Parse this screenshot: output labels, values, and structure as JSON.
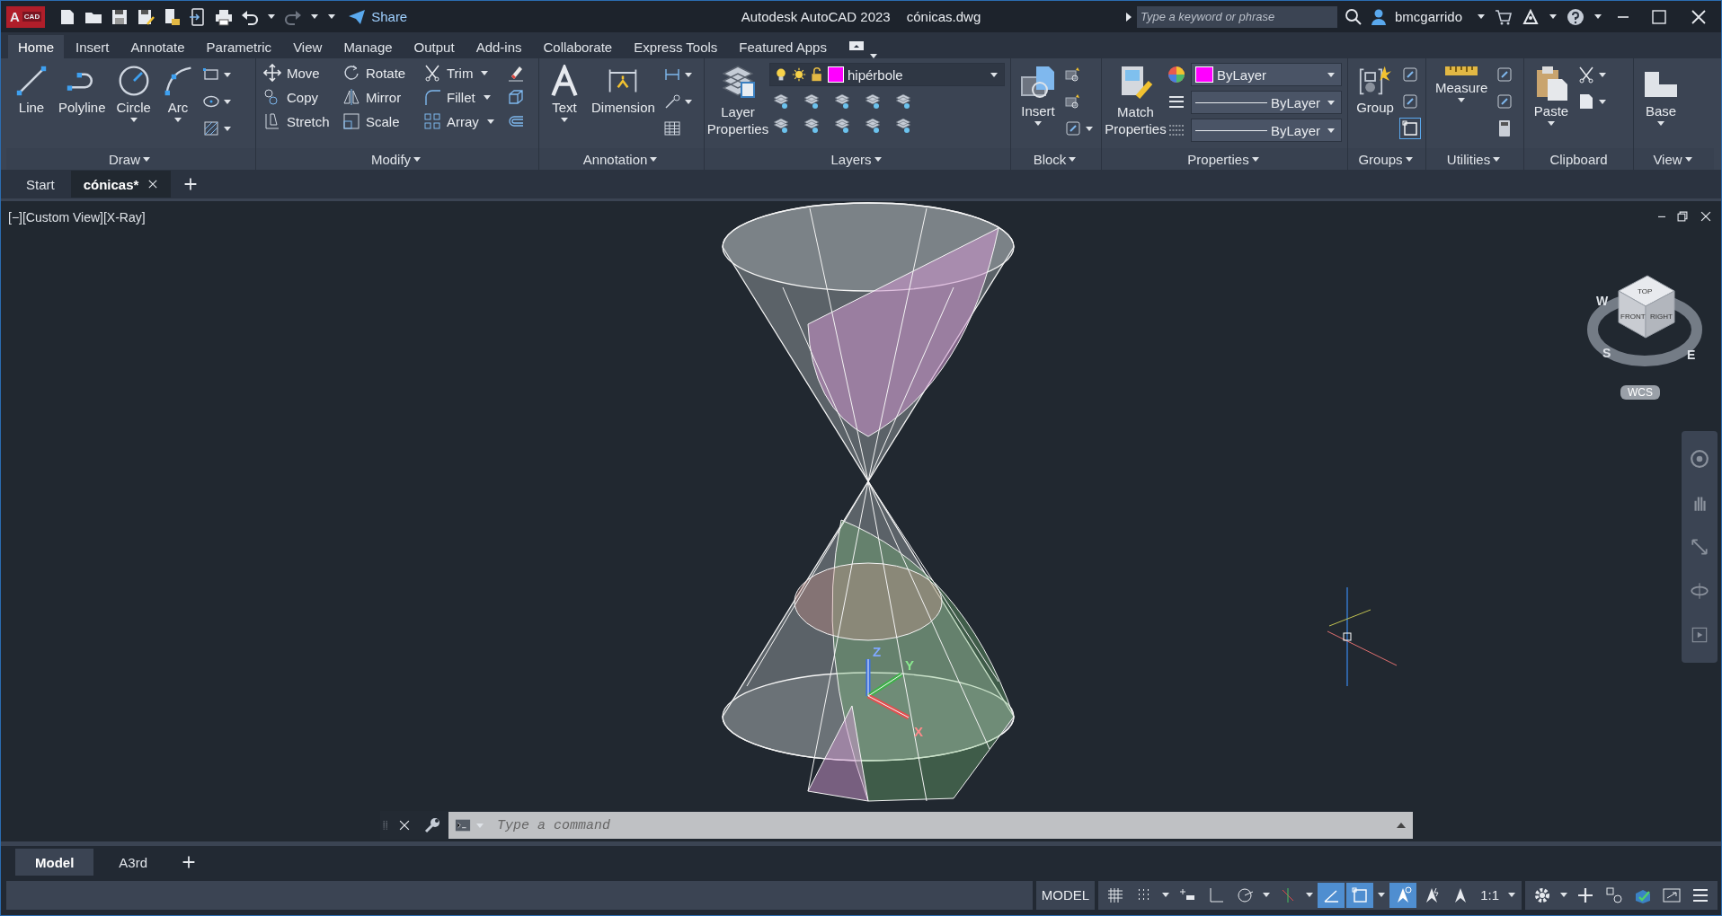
{
  "title_bar": {
    "logo_letter": "A",
    "logo_badge": "CAD",
    "share": "Share",
    "title": "Autodesk AutoCAD 2023",
    "file": "cónicas.dwg",
    "search": {
      "placeholder": "Type a keyword or phrase"
    },
    "user": "bmcgarrido"
  },
  "ribbon_tabs": [
    {
      "label": "Home",
      "selected": true
    },
    {
      "label": "Insert",
      "selected": false
    },
    {
      "label": "Annotate",
      "selected": false
    },
    {
      "label": "Parametric",
      "selected": false
    },
    {
      "label": "View",
      "selected": false
    },
    {
      "label": "Manage",
      "selected": false
    },
    {
      "label": "Output",
      "selected": false
    },
    {
      "label": "Add-ins",
      "selected": false
    },
    {
      "label": "Collaborate",
      "selected": false
    },
    {
      "label": "Express Tools",
      "selected": false
    },
    {
      "label": "Featured Apps",
      "selected": false
    }
  ],
  "draw": {
    "title": "Draw",
    "tools": [
      "Line",
      "Polyline",
      "Circle",
      "Arc"
    ]
  },
  "modify": {
    "title": "Modify",
    "rows": [
      [
        "Move",
        "Rotate",
        "Trim"
      ],
      [
        "Copy",
        "Mirror",
        "Fillet"
      ],
      [
        "Stretch",
        "Scale",
        "Array"
      ]
    ]
  },
  "annotation": {
    "title": "Annotation",
    "tools": [
      "Text",
      "Dimension"
    ]
  },
  "layers": {
    "title": "Layers",
    "tool": "Layer Properties",
    "current_layer": "hipérbole"
  },
  "block": {
    "title": "Block",
    "tool": "Insert"
  },
  "properties": {
    "title": "Properties",
    "tool": "Match Properties",
    "color": {
      "value": "ByLayer",
      "color": "#ff00ff"
    },
    "linetype": "ByLayer",
    "lineweight": "ByLayer"
  },
  "groups": {
    "title": "Groups",
    "tool": "Group"
  },
  "utilities": {
    "title": "Utilities",
    "tool": "Measure"
  },
  "clipboard": {
    "title": "Clipboard",
    "tool": "Paste"
  },
  "view": {
    "title": "View",
    "tool": "Base"
  },
  "file_tabs": [
    {
      "label": "Start",
      "selected": false
    },
    {
      "label": "cónicas*",
      "selected": true
    }
  ],
  "viewport": {
    "label": "[−][Custom View][X-Ray]",
    "viewcube": {
      "top": "TOP",
      "front": "FRONT",
      "right": "RIGHT",
      "compass": [
        "W",
        "S",
        "E"
      ],
      "ucs_menu": "WCS"
    },
    "ucs_axes": [
      "Z",
      "Y",
      "X"
    ]
  },
  "command_line": {
    "placeholder": "Type a command"
  },
  "layout_tabs": [
    {
      "label": "Model",
      "selected": true
    },
    {
      "label": "A3rd",
      "selected": false
    }
  ],
  "status_bar": {
    "space": "MODEL",
    "scale": "1:1",
    "toggles": [
      {
        "on": false
      },
      {
        "on": false
      },
      {
        "on": false
      },
      {
        "on": false
      },
      {
        "on": false
      },
      {
        "on": false
      },
      {
        "on": true
      },
      {
        "on": true
      },
      {
        "on": true
      },
      {
        "on": false
      },
      {
        "on": false
      }
    ]
  }
}
